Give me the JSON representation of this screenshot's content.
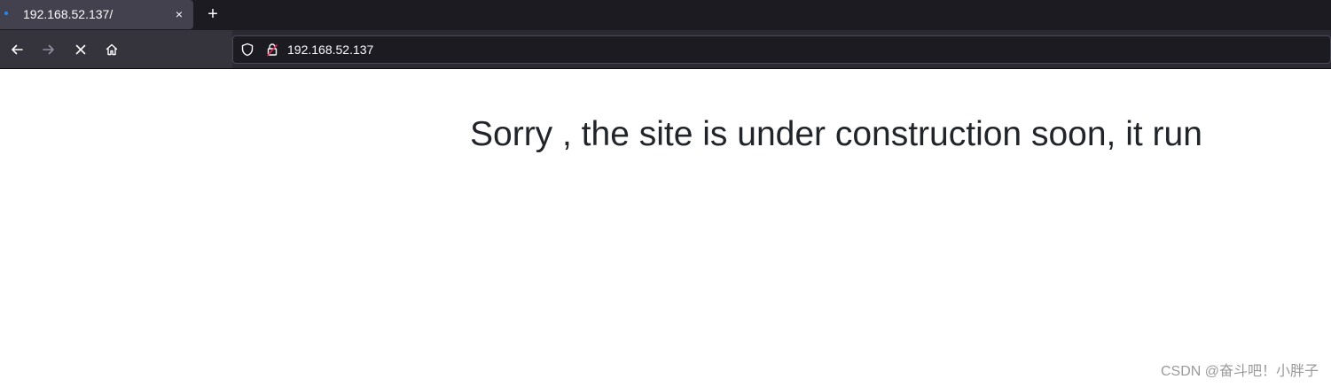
{
  "tab": {
    "title": "192.168.52.137/",
    "close_glyph": "×",
    "new_tab_glyph": "+"
  },
  "toolbar": {
    "back_icon": "arrow-left-icon",
    "forward_icon": "arrow-right-icon",
    "stop_icon": "stop-icon",
    "home_icon": "home-icon"
  },
  "urlbar": {
    "url": "192.168.52.137",
    "shield_icon": "shield-icon",
    "lock_icon": "insecure-lock-icon"
  },
  "page": {
    "headline": "Sorry , the site is under construction soon, it run"
  },
  "watermark": {
    "text": "CSDN @奋斗吧！小胖子"
  },
  "colors": {
    "tabstrip_bg": "#1c1b22",
    "active_tab_bg": "#42414d",
    "toolbar_bg": "#2b2a33",
    "loading_dot": "#1a8cff",
    "insecure_lock": "#e22850",
    "headline_text": "#212529"
  }
}
